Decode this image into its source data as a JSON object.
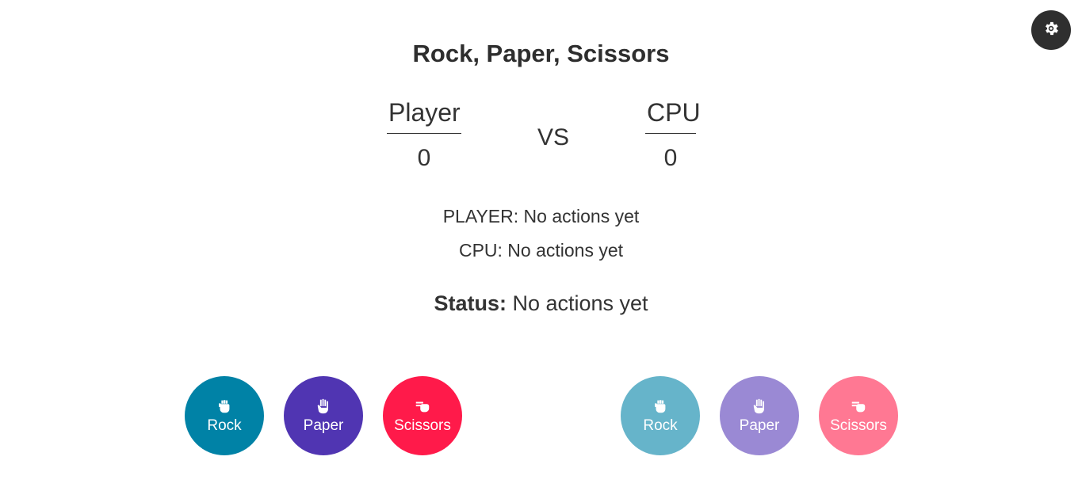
{
  "title": "Rock, Paper, Scissors",
  "scoreboard": {
    "player": {
      "name": "Player",
      "score": "0"
    },
    "cpu": {
      "name": "CPU",
      "score": "0"
    },
    "vs": "VS"
  },
  "actions": {
    "player": "PLAYER: No actions yet",
    "cpu": "CPU: No actions yet"
  },
  "status": {
    "label": "Status:",
    "value": " No actions yet"
  },
  "player_choices": [
    {
      "label": "Rock",
      "icon": "fist-icon",
      "color": "#0082a6"
    },
    {
      "label": "Paper",
      "icon": "open-hand-icon",
      "color": "#5035b2"
    },
    {
      "label": "Scissors",
      "icon": "scissors-hand-icon",
      "color": "#ff1a4a"
    }
  ],
  "cpu_choices": [
    {
      "label": "Rock",
      "icon": "fist-icon",
      "color": "#66b4ca"
    },
    {
      "label": "Paper",
      "icon": "open-hand-icon",
      "color": "#9a89d4"
    },
    {
      "label": "Scissors",
      "icon": "scissors-hand-icon",
      "color": "#ff7893"
    }
  ],
  "settings": {
    "icon": "gear-icon"
  }
}
